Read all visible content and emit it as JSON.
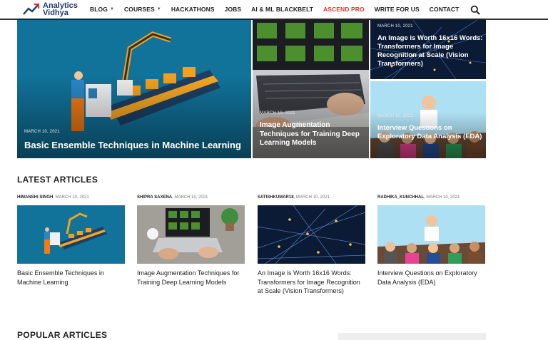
{
  "header": {
    "logo_line1": "Analytics",
    "logo_line2": "Vidhya",
    "nav": [
      {
        "label": "BLOG",
        "caret": true,
        "accent": false
      },
      {
        "label": "COURSES",
        "caret": true,
        "accent": false
      },
      {
        "label": "HACKATHONS",
        "caret": false,
        "accent": false
      },
      {
        "label": "JOBS",
        "caret": false,
        "accent": false
      },
      {
        "label": "AI & ML BLACKBELT",
        "caret": false,
        "accent": false
      },
      {
        "label": "ASCEND PRO",
        "caret": false,
        "accent": true
      },
      {
        "label": "WRITE FOR US",
        "caret": false,
        "accent": false
      },
      {
        "label": "CONTACT",
        "caret": false,
        "accent": false
      }
    ],
    "search_icon": "search-icon"
  },
  "hero": {
    "main": {
      "date": "MARCH 10, 2021",
      "title": "Basic Ensemble Techniques in Machine Learning"
    },
    "mid": {
      "date": "MARCH 10, 2021",
      "title": "Image Augmentation Techniques for Training Deep Learning Models"
    },
    "top_right": {
      "date": "MARCH 10, 2021",
      "title": "An Image is Worth 16x16 Words: Transformers for Image Recognition at Scale (Vision Transformers)"
    },
    "bottom_right": {
      "date": "MARCH 10, 2021",
      "title": "Interview Questions on Exploratory Data Analysis (EDA)"
    }
  },
  "latest": {
    "heading": "LATEST ARTICLES",
    "articles": [
      {
        "author": "HIMANSHI SINGH",
        "date": ", MARCH 10, 2021",
        "title": "Basic Ensemble Techniques in Machine Learning"
      },
      {
        "author": "SHIPRA SAXENA",
        "date": ", MARCH 10, 2021",
        "title": "Image Augmentation Techniques for Training Deep Learning Models"
      },
      {
        "author": "SATISHKUMAR18",
        "date": ", MARCH 10, 2021",
        "title": "An Image is Worth 16x16 Words: Transformers for Image Recognition at Scale (Vision Transformers)"
      },
      {
        "author": "RADHIKA_KUNCHHAL",
        "date": ", MARCH 10, 2021",
        "title": "Interview Questions on Exploratory Data Analysis (EDA)"
      }
    ]
  },
  "popular": {
    "heading": "POPULAR ARTICLES"
  },
  "colors": {
    "brand": "#1d3b6f",
    "accent": "#e8322c",
    "hero_blue": "#106b8f"
  }
}
